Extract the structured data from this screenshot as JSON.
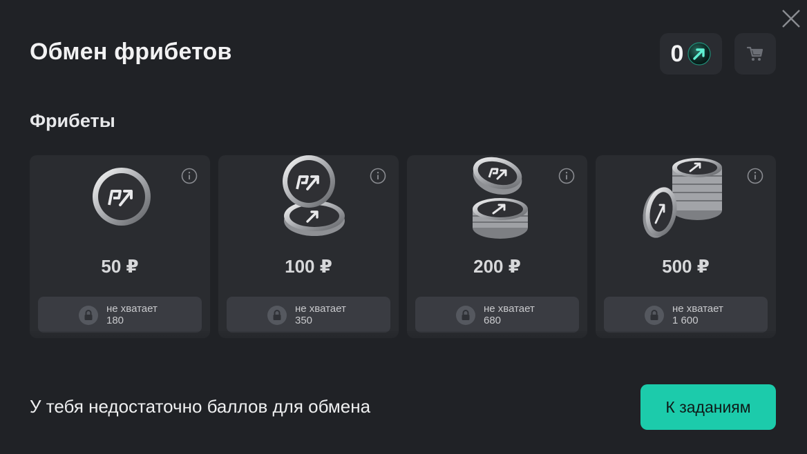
{
  "modal": {
    "title": "Обмен фрибетов",
    "balance": "0",
    "balance_icon": "arrow-coin-icon",
    "cart_icon": "cart-icon",
    "close_icon": "close-icon"
  },
  "section": {
    "title": "Фрибеты"
  },
  "cards": [
    {
      "price": "50 ₽",
      "lock_label": "не хватает",
      "missing": "180"
    },
    {
      "price": "100 ₽",
      "lock_label": "не хватает",
      "missing": "350"
    },
    {
      "price": "200 ₽",
      "lock_label": "не хватает",
      "missing": "680"
    },
    {
      "price": "500 ₽",
      "lock_label": "не хватает",
      "missing": "1 600"
    }
  ],
  "footer": {
    "message": "У тебя недостаточно баллов для обмена",
    "cta_label": "К заданиям"
  },
  "colors": {
    "background": "#202226",
    "card": "#2a2c30",
    "accent": "#1ccbab"
  }
}
